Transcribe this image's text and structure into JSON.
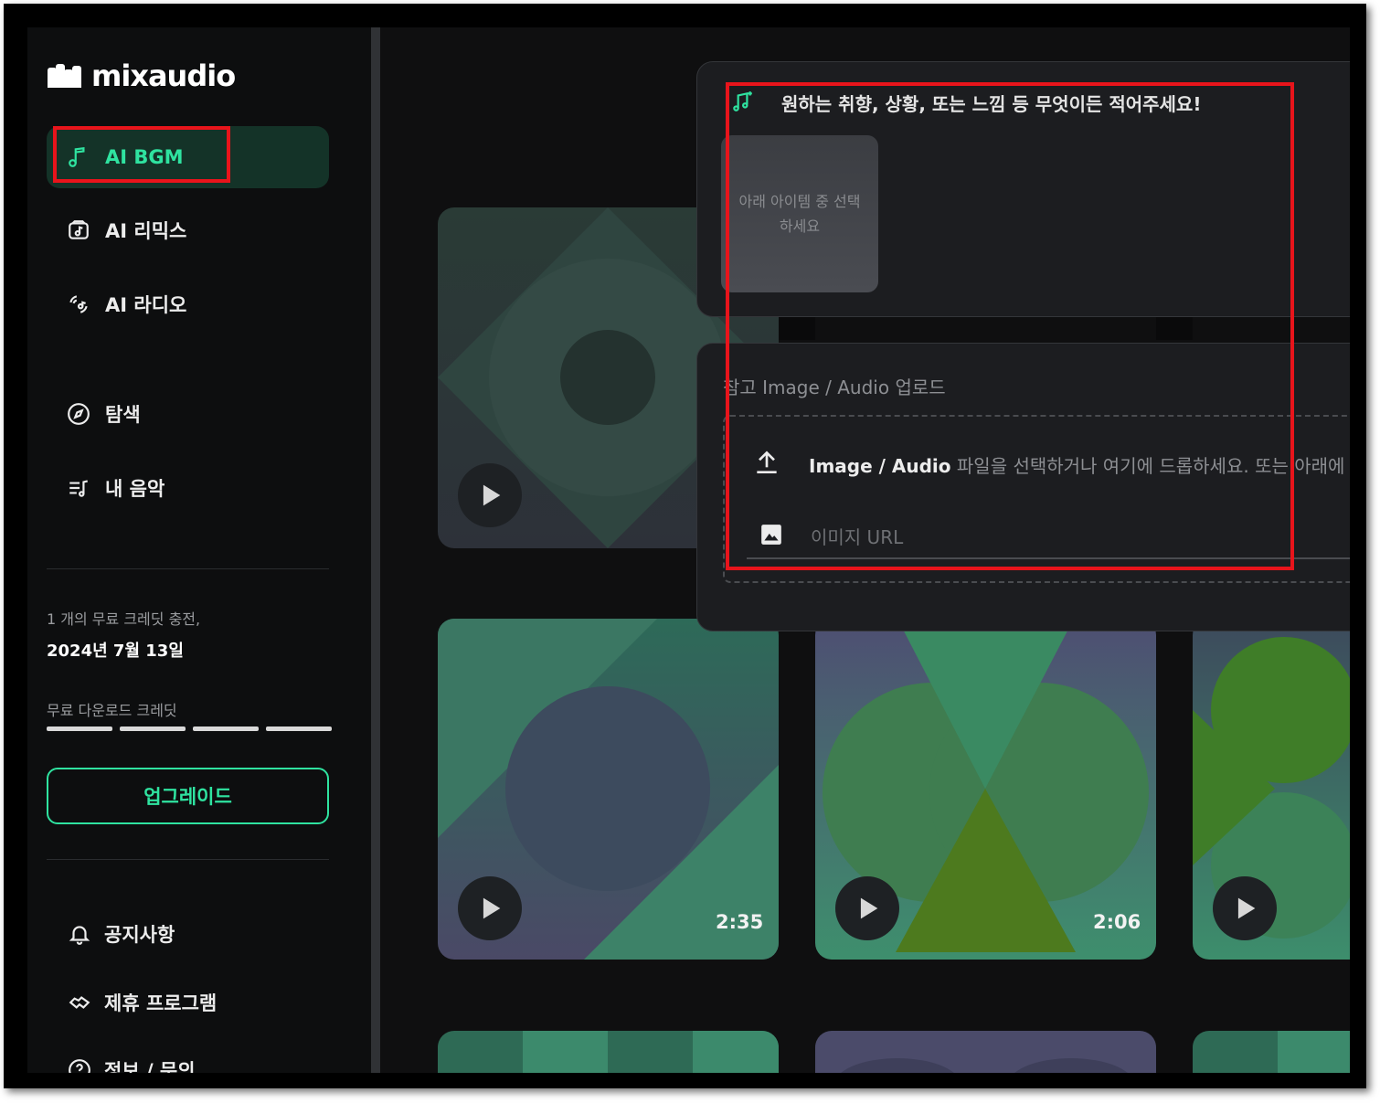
{
  "logo": {
    "text": "mixaudio"
  },
  "sidebar": {
    "items": [
      {
        "label": "AI BGM",
        "icon": "music-note-icon",
        "active": true
      },
      {
        "label": "AI 리믹스",
        "icon": "remix-icon",
        "active": false
      },
      {
        "label": "AI 라디오",
        "icon": "radio-icon",
        "active": false
      },
      {
        "label": "탐색",
        "icon": "compass-icon",
        "active": false
      },
      {
        "label": "내 음악",
        "icon": "playlist-icon",
        "active": false
      }
    ],
    "credits": {
      "note": "1 개의 무료 크레딧 충전,",
      "date": "2024년 7월 13일",
      "label": "무료 다운로드 크레딧",
      "segments": 4
    },
    "upgrade_label": "업그레이드",
    "footer": [
      {
        "label": "공지사항",
        "icon": "bell-icon"
      },
      {
        "label": "제휴 프로그램",
        "icon": "handshake-icon"
      },
      {
        "label": "정보 / 문의",
        "icon": "help-icon"
      }
    ]
  },
  "prompt_panel": {
    "placeholder": "원하는 취향, 상황, 또는 느낌 등 무엇이든 적어주세요!",
    "suggestion_tile": "아래 아이템 중 선택하세요"
  },
  "upload_panel": {
    "title": "참고 Image / Audio 업로드",
    "drop_lead": "Image / Audio",
    "drop_text": " 파일을 선택하거나 여기에 드롭하세요. 또는 아래에 U",
    "url_placeholder": "이미지 URL"
  },
  "cards": [
    {
      "duration": ""
    },
    {
      "duration": "2:35"
    },
    {
      "duration": "2:06"
    },
    {
      "duration": ""
    }
  ],
  "colors": {
    "accent": "#2fe3a0",
    "highlight": "#e8141b",
    "background": "#0f0f10"
  }
}
